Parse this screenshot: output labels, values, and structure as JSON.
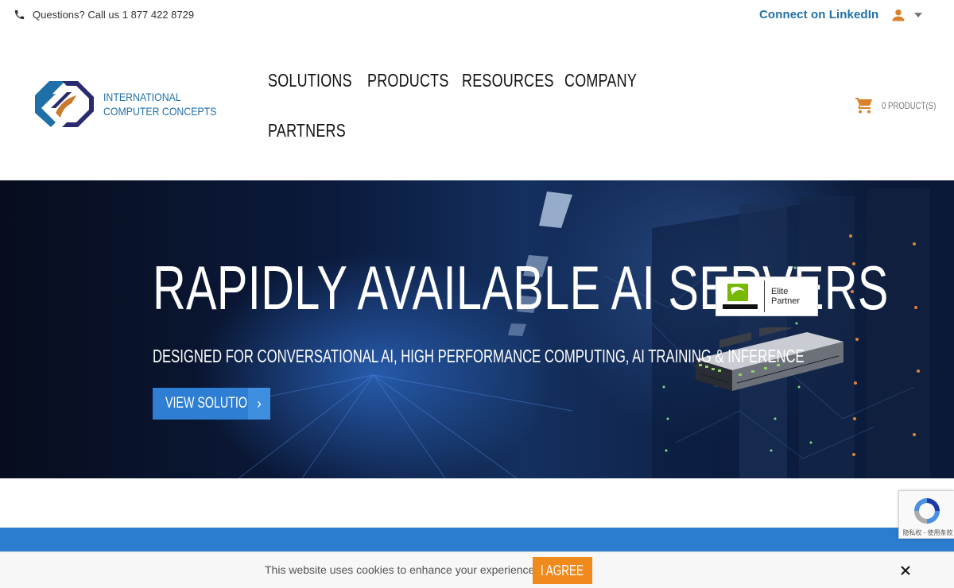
{
  "topbar": {
    "phone_text": "Questions? Call us 1 877 422 8729",
    "linkedin_label": "Connect on LinkedIn"
  },
  "header": {
    "logo_line1": "INTERNATIONAL",
    "logo_line2": "COMPUTER CONCEPTS",
    "nav": [
      "SOLUTIONS",
      "PRODUCTS",
      "RESOURCES",
      "COMPANY",
      "PARTNERS"
    ],
    "cart_label": "0 PRODUCT(S)"
  },
  "hero": {
    "title": "RAPIDLY AVAILABLE AI SERVERS",
    "subtitle": "DESIGNED FOR CONVERSATIONAL AI, HIGH PERFORMANCE COMPUTING, AI TRAINING & INFERENCE",
    "button_label": "VIEW SOLUTION",
    "button_arrow": "›",
    "badge_line1": "Elite",
    "badge_line2": "Partner"
  },
  "recaptcha": {
    "label": "隐私权 - 使用条款"
  },
  "cookie": {
    "text": "This website uses cookies to enhance your experience.",
    "agree_label": "I AGREE"
  },
  "colors": {
    "brand_blue": "#1f6fa8",
    "accent_orange": "#f08a1c",
    "band_blue": "#2a7dcf",
    "icon_orange": "#d9822b"
  },
  "icons": {
    "phone": "phone-icon",
    "user": "user-icon",
    "caret": "chevron-down-icon",
    "cart": "cart-icon",
    "arrow": "chevron-right-icon",
    "close": "close-icon",
    "recaptcha": "recaptcha-icon"
  }
}
